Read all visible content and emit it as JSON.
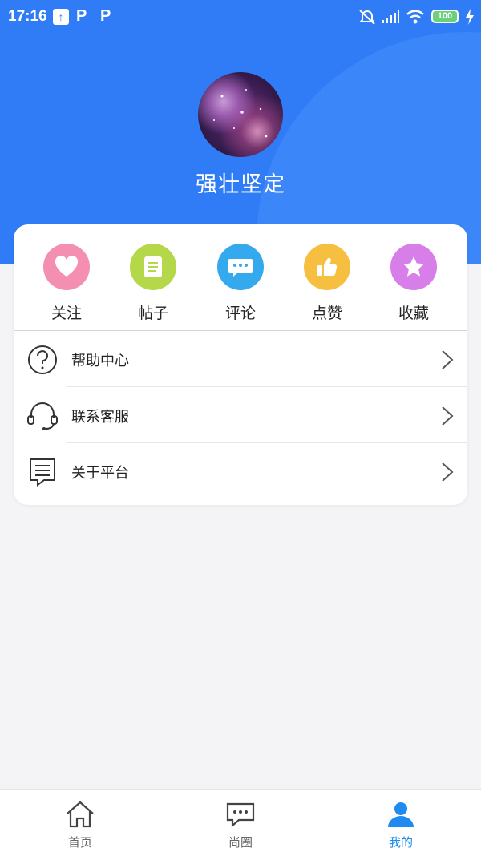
{
  "status_bar": {
    "time": "17:16",
    "upload_icon": "upload-arrow-icon",
    "p_marks": [
      "P",
      "P"
    ],
    "battery": "100",
    "icons": [
      "mute-bell-icon",
      "signal-icon",
      "wifi-icon",
      "battery-icon",
      "charging-icon"
    ]
  },
  "profile": {
    "username": "强壮坚定",
    "avatar": "galaxy-avatar-image"
  },
  "quick_actions": [
    {
      "label": "关注",
      "icon": "heart-icon",
      "color": "#f48fb1"
    },
    {
      "label": "帖子",
      "icon": "document-icon",
      "color": "#b5d84a"
    },
    {
      "label": "评论",
      "icon": "chat-bubble-icon",
      "color": "#35a9ee"
    },
    {
      "label": "点赞",
      "icon": "thumbs-up-icon",
      "color": "#f7bf3f"
    },
    {
      "label": "收藏",
      "icon": "star-icon",
      "color": "#d77ee8"
    }
  ],
  "menu": [
    {
      "label": "帮助中心",
      "icon": "question-circle-icon"
    },
    {
      "label": "联系客服",
      "icon": "headset-icon"
    },
    {
      "label": "关于平台",
      "icon": "document-list-icon"
    }
  ],
  "tabs": [
    {
      "label": "首页",
      "icon": "home-icon",
      "active": false
    },
    {
      "label": "尚圈",
      "icon": "message-icon",
      "active": false
    },
    {
      "label": "我的",
      "icon": "user-icon",
      "active": true
    }
  ],
  "colors": {
    "header_blue": "#2f7cf6",
    "tab_active": "#1f8bf0",
    "background": "#f4f4f6"
  }
}
